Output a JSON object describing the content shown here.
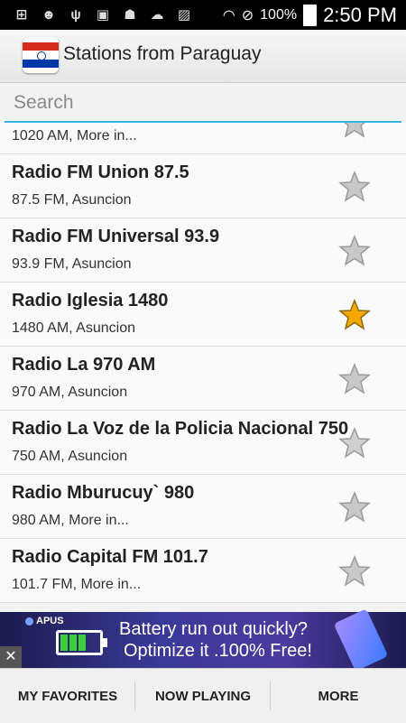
{
  "status_bar": {
    "battery_percent": "100%",
    "time": "2:50 PM"
  },
  "app_bar": {
    "title": "Stations from Paraguay"
  },
  "search": {
    "placeholder": "Search",
    "value": ""
  },
  "stations": [
    {
      "name": "",
      "sub": "1020 AM, More in...",
      "favorite": false
    },
    {
      "name": "Radio FM Union 87.5",
      "sub": "87.5 FM, Asuncion",
      "favorite": false
    },
    {
      "name": "Radio FM Universal 93.9",
      "sub": "93.9 FM, Asuncion",
      "favorite": false
    },
    {
      "name": "Radio Iglesia 1480",
      "sub": "1480 AM, Asuncion",
      "favorite": true
    },
    {
      "name": "Radio La 970 AM",
      "sub": "970 AM, Asuncion",
      "favorite": false
    },
    {
      "name": "Radio La Voz de la Policia Nacional 750",
      "sub": "750 AM, Asuncion",
      "favorite": false
    },
    {
      "name": "Radio Mburucuy` 980",
      "sub": "980 AM, More in...",
      "favorite": false
    },
    {
      "name": "Radio Capital FM 101.7",
      "sub": "101.7 FM, More in...",
      "favorite": false
    }
  ],
  "ad": {
    "brand": "APUS",
    "line1": "Battery run out quickly?",
    "line2": "Optimize it .100% Free!",
    "close": "✕"
  },
  "bottom_tabs": [
    "MY FAVORITES",
    "NOW PLAYING",
    "MORE"
  ],
  "colors": {
    "accent": "#33b5e5",
    "star_on": "#f5a800",
    "star_off": "#c8c8c8"
  }
}
